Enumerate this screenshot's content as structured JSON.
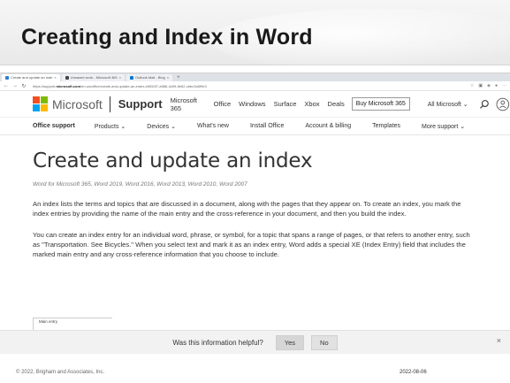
{
  "slide": {
    "title": "Creating and Index in Word",
    "footer_left": "© 2022, Brigham and Associates, Inc.",
    "footer_right": "2022-08-06"
  },
  "browser": {
    "tabs": [
      {
        "label": "Create and update an inde",
        "color": "#2b7cd3"
      },
      {
        "label": "Unsaved work - Microsoft 365",
        "color": "#444444"
      },
      {
        "label": "Outlook Mail - Bing",
        "color": "#0078d4"
      }
    ],
    "url_prefix": "https://support.",
    "url_domain": "microsoft.com",
    "url_suffix": "/en-us/office/create-and-update-an-index-e6052f7-a986-4c59-8e62-cbbc3a5f9e3"
  },
  "ms_header": {
    "brand": "Microsoft",
    "support": "Support",
    "nav": [
      "Microsoft 365",
      "Office",
      "Windows",
      "Surface",
      "Xbox",
      "Deals"
    ],
    "buy_label": "Buy Microsoft 365",
    "all_microsoft": "All Microsoft ⌄",
    "logo_colors": [
      "#f25022",
      "#7fba00",
      "#00a4ef",
      "#ffb900"
    ]
  },
  "sub_nav": [
    {
      "label": "Office support",
      "bold": true
    },
    {
      "label": "Products ⌄",
      "bold": false
    },
    {
      "label": "Devices ⌄",
      "bold": false
    },
    {
      "label": "What's new",
      "bold": false
    },
    {
      "label": "Install Office",
      "bold": false
    },
    {
      "label": "Account & billing",
      "bold": false
    },
    {
      "label": "Templates",
      "bold": false
    },
    {
      "label": "More support ⌄",
      "bold": false
    }
  ],
  "article": {
    "title": "Create and update an index",
    "applies_to": "Word for Microsoft 365, Word 2019, Word 2016, Word 2013, Word 2010, Word 2007",
    "para1": "An index lists the terms and topics that are discussed in a document, along with the pages that they appear on. To create an index, you mark the index entries by providing the name of the main entry and the cross-reference in your document, and then you build the index.",
    "para2": "You can create an index entry for an individual word, phrase, or symbol, for a topic that spans a range of pages, or that refers to another entry, such as \"Transportation. See Bicycles.\" When you select text and mark it as an index entry, Word adds a special XE (Index Entry) field that includes the marked main entry and any cross-reference information that you choose to include.",
    "figure_label": "Main entry"
  },
  "feedback": {
    "question": "Was this information helpful?",
    "yes": "Yes",
    "no": "No"
  }
}
